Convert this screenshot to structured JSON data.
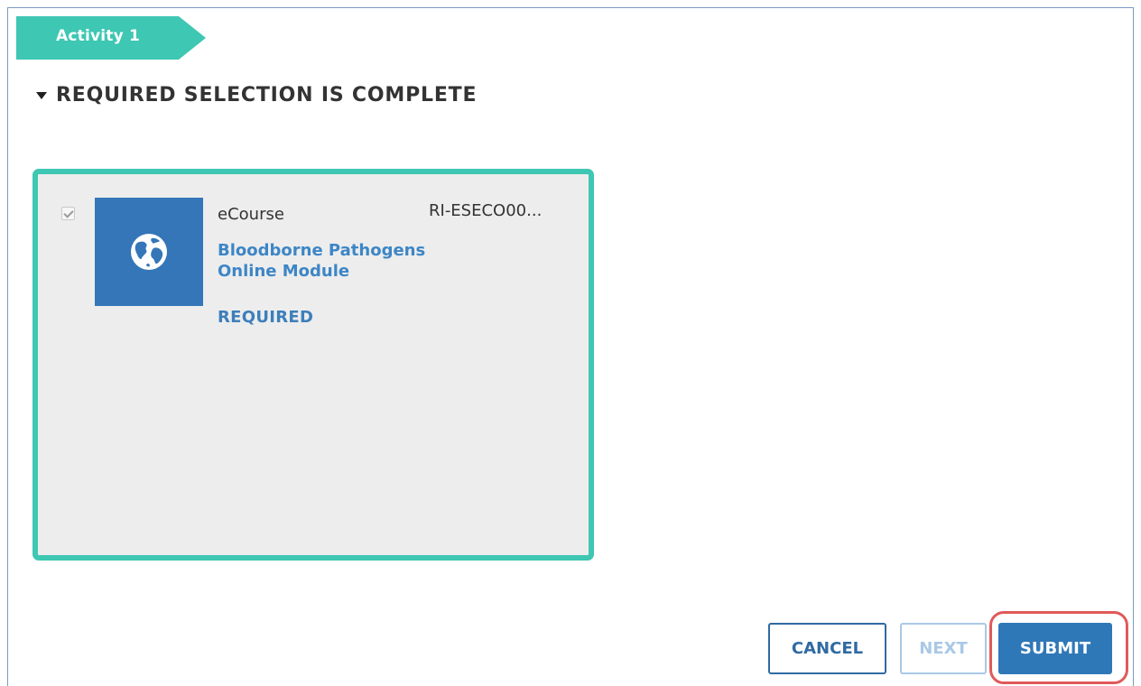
{
  "activity": {
    "label": "Activity 1"
  },
  "section": {
    "title": "REQUIRED SELECTION IS COMPLETE"
  },
  "item": {
    "checked": true,
    "content_type": "eCourse",
    "code": "RI-ESECO00...",
    "title": "Bloodborne Pathogens Online Module",
    "status": "REQUIRED",
    "icon": "globe-icon"
  },
  "actions": {
    "cancel_label": "CANCEL",
    "next_label": "NEXT",
    "submit_label": "SUBMIT"
  },
  "colors": {
    "accent_teal": "#3ec7b3",
    "primary_blue": "#2f78b8",
    "link_blue": "#3d86c6",
    "highlight_red": "#e05a5a"
  }
}
